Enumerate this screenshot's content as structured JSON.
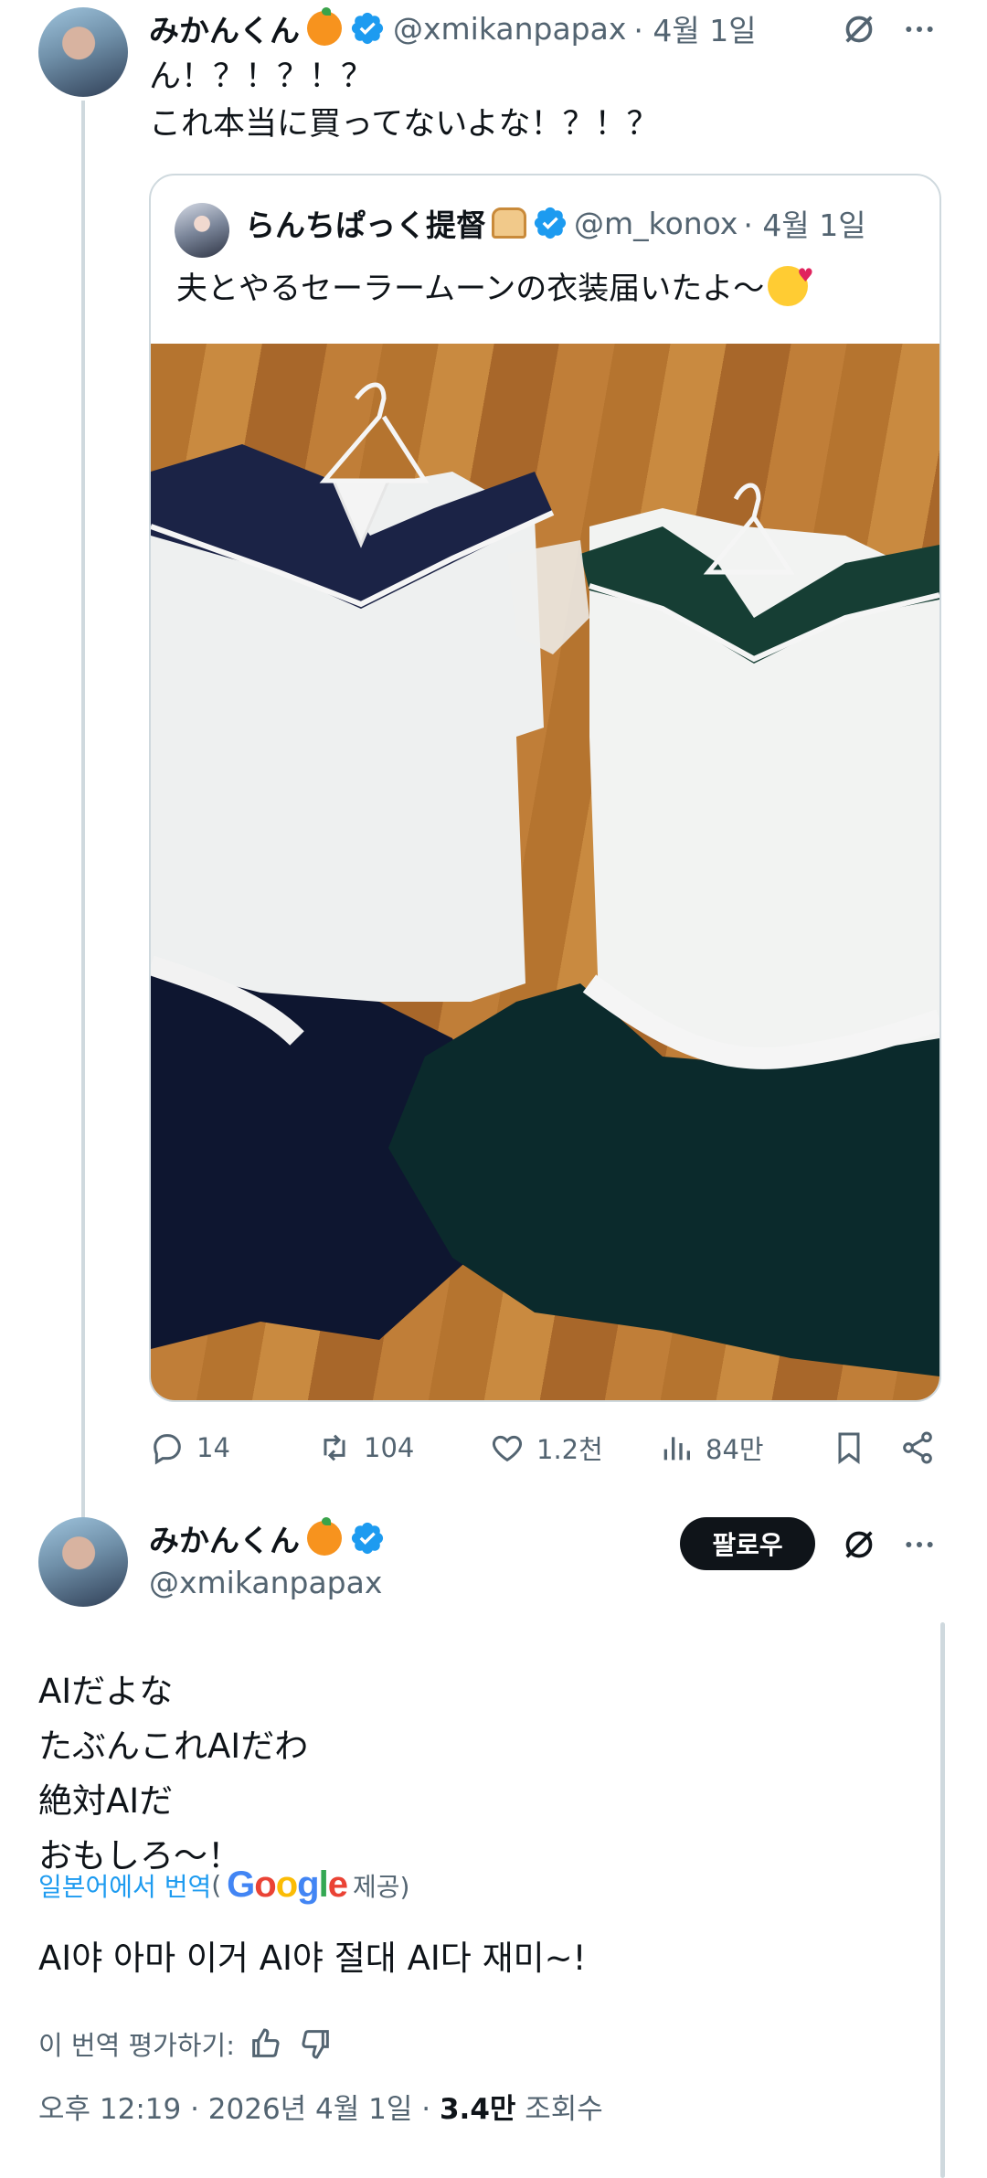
{
  "colors": {
    "accent": "#1d9bf0",
    "text": "#0f1419",
    "muted": "#536471",
    "border": "#cfd9de"
  },
  "post1": {
    "name": "みかんくん",
    "handle": "@xmikanpapax",
    "date": "· 4월 1일",
    "line1": "ん！？！？！？",
    "line2": "これ本当に買ってないよな！？！？"
  },
  "quote": {
    "name": "らんちぱっく提督",
    "handle": "@m_konox",
    "date": "· 4월 1일",
    "text": "夫とやるセーラームーンの衣装届いたよ〜"
  },
  "actions": {
    "replies": "14",
    "reposts": "104",
    "likes": "1.2천",
    "views": "84만"
  },
  "post2": {
    "name": "みかんくん",
    "handle": "@xmikanpapax",
    "follow_label": "팔로우",
    "lines": [
      "AIだよな",
      "たぶんこれAIだわ",
      "絶対AIだ",
      "おもしろ〜！"
    ],
    "translate_link": "일본어에서 번역",
    "translate_open": "(",
    "google": "Google",
    "translate_provider": "제공)",
    "translation": "AI야 아마 이거 AI야 절대 AI다 재미~!",
    "rate_label": "이 번역 평가하기:",
    "time": "오후 12:19 · 2026년 4월 1일 · ",
    "views_count": "3.4만",
    "views_label": " 조회수"
  }
}
